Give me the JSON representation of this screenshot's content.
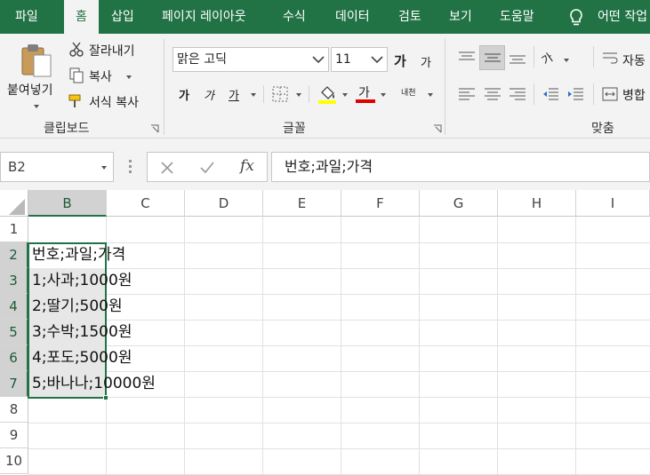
{
  "tabs": [
    "파일",
    "홈",
    "삽입",
    "페이지 레이아웃",
    "수식",
    "데이터",
    "검토",
    "보기",
    "도움말",
    "어떤 작업"
  ],
  "active_tab": "홈",
  "ribbon": {
    "clipboard": {
      "paste_label": "붙여넣기",
      "cut_label": "잘라내기",
      "copy_label": "복사",
      "format_painter_label": "서식 복사",
      "group_label": "클립보드"
    },
    "font": {
      "font_name": "맑은 고딕",
      "font_size": "11",
      "increase_size_label": "가",
      "decrease_size_label": "가",
      "bold_label": "가",
      "italic_label": "가",
      "underline_label": "가",
      "font_color_label": "가",
      "phonetic_label": "내천",
      "group_label": "글꼴",
      "fill_color": "#ffff00",
      "font_color": "#e00000"
    },
    "alignment": {
      "orientation_label": "가",
      "wrap_label": "자동",
      "merge_label": "병합",
      "group_label": "맞춤"
    }
  },
  "formula_bar": {
    "name_box": "B2",
    "cancel_icon": "close-icon",
    "enter_icon": "check-icon",
    "fx_label": "fx",
    "formula": "번호;과일;가격"
  },
  "columns": [
    "B",
    "C",
    "D",
    "E",
    "F",
    "G",
    "H",
    "I"
  ],
  "rows": [
    "1",
    "2",
    "3",
    "4",
    "5",
    "6",
    "7",
    "8",
    "9",
    "10"
  ],
  "cells": {
    "B2": "번호;과일;가격",
    "B3": "1;사과;1000원",
    "B4": "2;딸기;500원",
    "B5": "3;수박;1500원",
    "B6": "4;포도;5000원",
    "B7": "5;바나나;10000원"
  },
  "theme": {
    "accent": "#217346",
    "selection_fill": "#e7e7e7"
  }
}
